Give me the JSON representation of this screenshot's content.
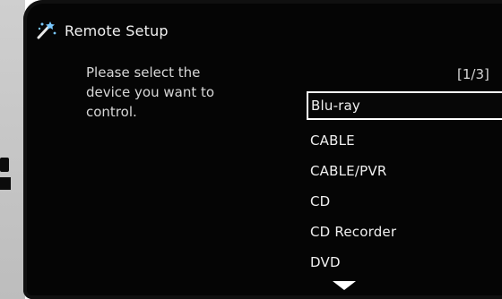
{
  "header": {
    "title": "Remote Setup",
    "icon": "magic-wand-icon"
  },
  "instruction": {
    "text": "Please select the\ndevice you want to\ncontrol."
  },
  "pagination": {
    "label": "[1/3]"
  },
  "devices": [
    {
      "label": "Blu-ray",
      "selected": true
    },
    {
      "label": "CABLE",
      "selected": false
    },
    {
      "label": "CABLE/PVR",
      "selected": false
    },
    {
      "label": "CD",
      "selected": false
    },
    {
      "label": "CD Recorder",
      "selected": false
    },
    {
      "label": "DVD",
      "selected": false
    }
  ],
  "scroll": {
    "icon": "down-arrow-icon"
  },
  "colors": {
    "background": "#050505",
    "text": "#f0f0f0",
    "selection_border": "#ffffff"
  }
}
